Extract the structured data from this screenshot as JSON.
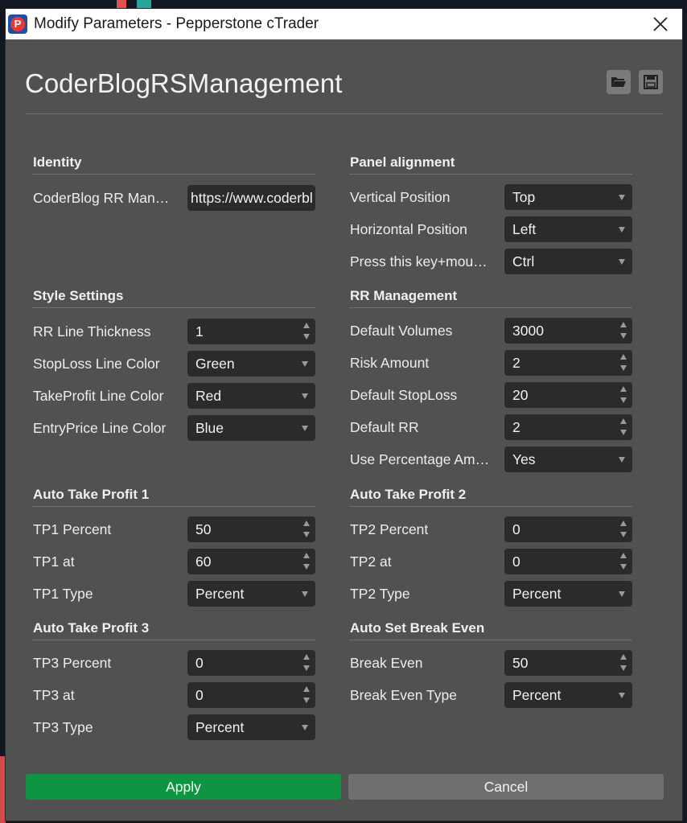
{
  "window": {
    "title": "Modify Parameters - Pepperstone cTrader",
    "close_icon": "close-icon"
  },
  "header": {
    "title": "CoderBlogRSManagement",
    "open_icon": "folder-open-icon",
    "save_icon": "save-icon"
  },
  "left_sections": [
    {
      "title": "Identity",
      "rows": [
        {
          "label": "CoderBlog RR Man…",
          "value": "https://www.coderbl",
          "type": "text"
        }
      ]
    },
    {
      "title": "Style Settings",
      "rows": [
        {
          "label": "RR Line Thickness",
          "value": "1",
          "type": "spin"
        },
        {
          "label": "StopLoss Line Color",
          "value": "Green",
          "type": "select"
        },
        {
          "label": "TakeProfit Line Color",
          "value": "Red",
          "type": "select"
        },
        {
          "label": "EntryPrice Line Color",
          "value": "Blue",
          "type": "select"
        }
      ]
    },
    {
      "title": "Auto Take Profit 1",
      "rows": [
        {
          "label": "TP1 Percent",
          "value": "50",
          "type": "spin"
        },
        {
          "label": "TP1 at",
          "value": "60",
          "type": "spin"
        },
        {
          "label": "TP1 Type",
          "value": "Percent",
          "type": "select"
        }
      ]
    },
    {
      "title": "Auto Take Profit 3",
      "rows": [
        {
          "label": "TP3 Percent",
          "value": "0",
          "type": "spin"
        },
        {
          "label": "TP3 at",
          "value": "0",
          "type": "spin"
        },
        {
          "label": "TP3 Type",
          "value": "Percent",
          "type": "select"
        }
      ]
    }
  ],
  "right_sections": [
    {
      "title": "Panel alignment",
      "rows": [
        {
          "label": "Vertical Position",
          "value": "Top",
          "type": "select"
        },
        {
          "label": "Horizontal Position",
          "value": "Left",
          "type": "select"
        },
        {
          "label": "Press this key+mou…",
          "value": "Ctrl",
          "type": "select"
        }
      ]
    },
    {
      "title": "RR Management",
      "rows": [
        {
          "label": "Default Volumes",
          "value": "3000",
          "type": "spin"
        },
        {
          "label": "Risk Amount",
          "value": "2",
          "type": "spin"
        },
        {
          "label": "Default StopLoss",
          "value": "20",
          "type": "spin"
        },
        {
          "label": "Default RR",
          "value": "2",
          "type": "spin"
        },
        {
          "label": "Use Percentage Am…",
          "value": "Yes",
          "type": "select"
        }
      ]
    },
    {
      "title": "Auto Take Profit 2",
      "rows": [
        {
          "label": "TP2 Percent",
          "value": "0",
          "type": "spin"
        },
        {
          "label": "TP2 at",
          "value": "0",
          "type": "spin"
        },
        {
          "label": "TP2 Type",
          "value": "Percent",
          "type": "select"
        }
      ]
    },
    {
      "title": "Auto Set Break Even",
      "rows": [
        {
          "label": "Break Even",
          "value": "50",
          "type": "spin"
        },
        {
          "label": "Break Even Type",
          "value": "Percent",
          "type": "select"
        }
      ]
    }
  ],
  "footer": {
    "apply_label": "Apply",
    "cancel_label": "Cancel",
    "apply_color": "#0f9441",
    "cancel_color": "#6f6f6f"
  }
}
